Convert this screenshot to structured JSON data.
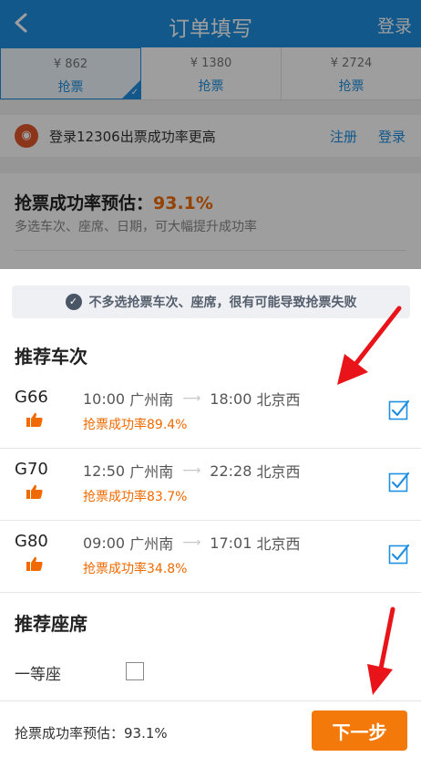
{
  "header": {
    "title": "订单填写",
    "login": "登录"
  },
  "seat_tabs": [
    {
      "price": "¥ 862",
      "grab": "抢票",
      "selected": true
    },
    {
      "price": "¥ 1380",
      "grab": "抢票",
      "selected": false
    },
    {
      "price": "¥ 2724",
      "grab": "抢票",
      "selected": false
    }
  ],
  "login_banner": {
    "text": "登录12306出票成功率更高",
    "register": "注册",
    "login": "登录"
  },
  "rate_card": {
    "title_prefix": "抢票成功率预估：",
    "rate": "93.1%",
    "subtitle": "多选车次、座席、日期，可大幅提升成功率"
  },
  "sheet": {
    "notice": "不多选抢票车次、座席，很有可能导致抢票失败",
    "recommend_trains_title": "推荐车次",
    "trains": [
      {
        "code": "G66",
        "depart_time": "10:00",
        "depart_station": "广州南",
        "arrive_time": "18:00",
        "arrive_station": "北京西",
        "rate": "抢票成功率89.4%",
        "checked": true
      },
      {
        "code": "G70",
        "depart_time": "12:50",
        "depart_station": "广州南",
        "arrive_time": "22:28",
        "arrive_station": "北京西",
        "rate": "抢票成功率83.7%",
        "checked": true
      },
      {
        "code": "G80",
        "depart_time": "09:00",
        "depart_station": "广州南",
        "arrive_time": "17:01",
        "arrive_station": "北京西",
        "rate": "抢票成功率34.8%",
        "checked": true
      }
    ],
    "recommend_seats_title": "推荐座席",
    "seat_options": [
      {
        "label": "一等座",
        "checked": false
      }
    ]
  },
  "footer": {
    "rate_text": "抢票成功率预估：93.1%",
    "next_button": "下一步"
  },
  "colors": {
    "header_blue": "#1f8fe0",
    "accent_orange": "#f06a00",
    "button_orange": "#f3790a",
    "annotation_red": "#e8141a"
  },
  "icons": {
    "back": "chevron-left-icon",
    "thumb": "thumbs-up-icon",
    "checkbox_checked": "checkbox-checked-icon"
  }
}
